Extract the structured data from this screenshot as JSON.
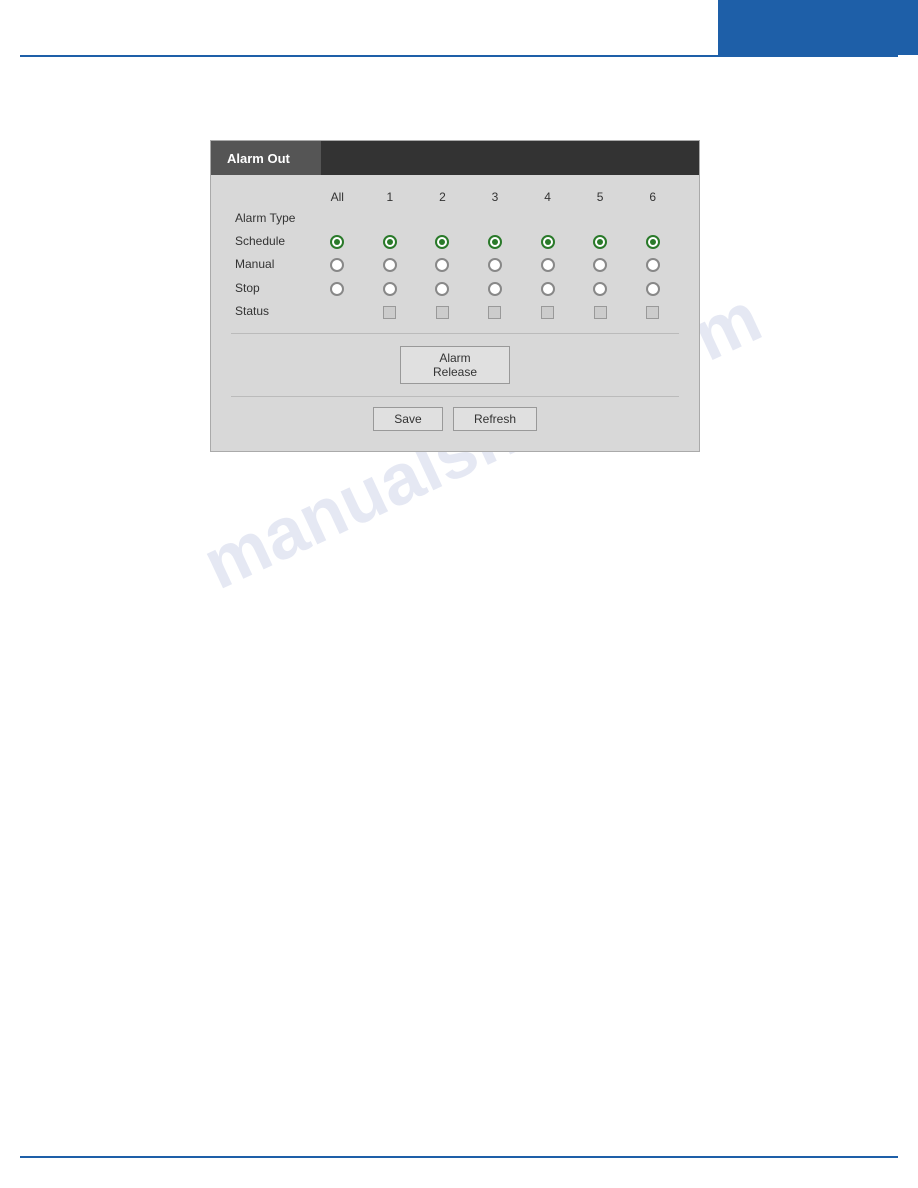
{
  "page": {
    "watermark": "manualshive.com"
  },
  "card": {
    "header_title": "Alarm Out",
    "table": {
      "columns": [
        "All",
        "1",
        "2",
        "3",
        "4",
        "5",
        "6"
      ],
      "rows": [
        {
          "label": "Alarm Type",
          "type": "header_labels"
        },
        {
          "label": "Schedule",
          "type": "radio",
          "checked_all": true,
          "checked": [
            true,
            true,
            true,
            true,
            true,
            true,
            true
          ]
        },
        {
          "label": "Manual",
          "type": "radio",
          "checked_all": false,
          "checked": [
            false,
            false,
            false,
            false,
            false,
            false,
            false
          ]
        },
        {
          "label": "Stop",
          "type": "radio",
          "checked_all": false,
          "checked": [
            false,
            false,
            false,
            false,
            false,
            false,
            false
          ]
        },
        {
          "label": "Status",
          "type": "checkbox",
          "checked": [
            false,
            false,
            false,
            false,
            false,
            false
          ]
        }
      ]
    },
    "alarm_release_label": "Alarm Release",
    "save_label": "Save",
    "refresh_label": "Refresh"
  }
}
